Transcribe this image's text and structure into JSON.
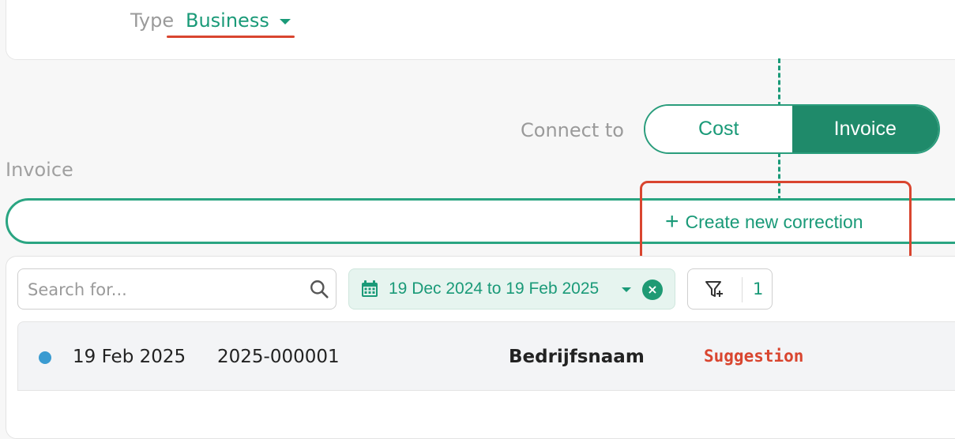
{
  "colors": {
    "background": "#f7f7f7",
    "accent": "#1a9a78",
    "accent_dark": "#1f8a6a",
    "highlight_red": "#d9452f",
    "status_dot": "#3a9bd1"
  },
  "type_selector": {
    "label": "Type",
    "value": "Business",
    "icon": "caret-down-icon"
  },
  "connect": {
    "label": "Connect to",
    "options": [
      "Cost",
      "Invoice"
    ],
    "selected": "Invoice"
  },
  "invoice_section": {
    "label": "Invoice",
    "create_button": {
      "icon": "plus-icon",
      "label": "Create new correction"
    }
  },
  "toolbar": {
    "search": {
      "placeholder": "Search for...",
      "value": "",
      "icon": "search-icon"
    },
    "date_range": {
      "icon": "calendar-icon",
      "label": "19 Dec 2024 to 19 Feb 2025",
      "clear_icon": "close-icon"
    },
    "filter": {
      "icon": "filter-add-icon",
      "count": "1"
    }
  },
  "rows": [
    {
      "date": "19 Feb 2025",
      "number": "2025-000001",
      "company": "Bedrijfsnaam",
      "status": "Suggestion"
    }
  ]
}
